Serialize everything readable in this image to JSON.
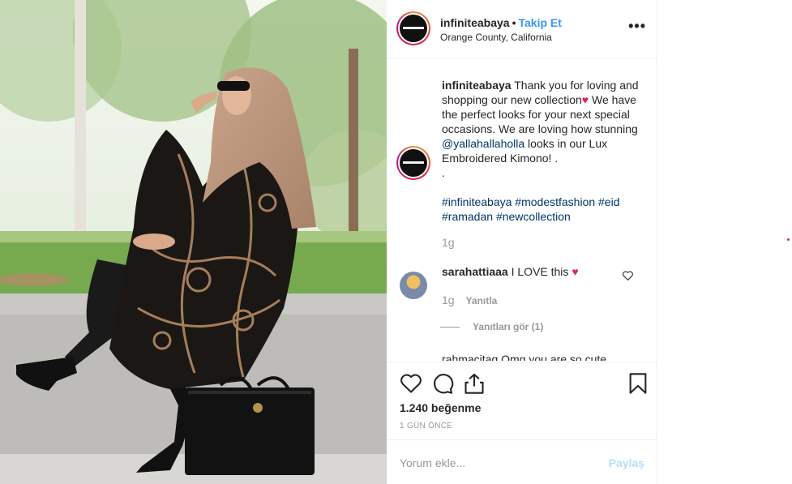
{
  "post": {
    "username": "infiniteabaya",
    "separator": "•",
    "follow_label": "Takip Et",
    "location": "Orange County, California",
    "more_label": "•••"
  },
  "caption": {
    "username": "infiniteabaya",
    "text_1": " Thank you for loving and shopping our new collection",
    "heart": "♥",
    "text_2": " We have the perfect looks for your next special occasions. We are loving how stunning ",
    "mention": "@yallahallaholla",
    "text_3": " looks in our Lux Embroidered Kimono! .",
    "dot_line": ".",
    "hashtags": [
      "#infiniteabaya",
      "#modestfashion",
      "#eid",
      "#ramadan",
      "#newcollection"
    ],
    "time": "1g"
  },
  "comments": [
    {
      "username": "sarahattiaaa",
      "text": " I LOVE this ",
      "heart": "♥",
      "time": "1g",
      "reply_label": "Yanıtla",
      "view_replies_label": "Yanıtları gör (1)"
    }
  ],
  "cut_comment": "rahmacitag Omg you are so cute",
  "actions": {
    "likes": "1.240 beğenme",
    "time_ago": "1 GÜN ÖNCE"
  },
  "comment_box": {
    "placeholder": "Yorum ekle...",
    "share_label": "Paylaş"
  },
  "colors": {
    "link": "#3897f0",
    "mention": "#003569",
    "heart": "#e0245e",
    "share_disabled": "#b2dffc"
  }
}
